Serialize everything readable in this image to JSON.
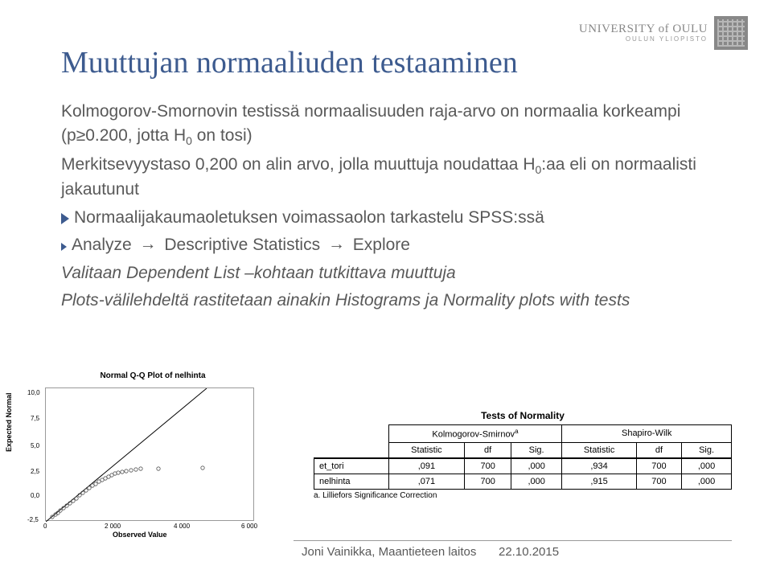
{
  "header": {
    "university": "UNIVERSITY of OULU",
    "sub": "OULUN YLIOPISTO"
  },
  "title": "Muuttujan normaaliuden testaaminen",
  "body": {
    "l1a": "Kolmogorov-Smornovin testissä normaalisuuden raja-arvo on normaalia korkeampi (p≥0.200, jotta H",
    "l1b": " on tosi)",
    "sub0": "0",
    "l2a": "Merkitsevyystaso 0,200 on alin arvo, jolla muuttuja noudattaa H",
    "l2b": ":aa eli on normaalisti jakautunut",
    "l3": "Normaalijakaumaoletuksen voimassaolon tarkastelu SPSS:ssä",
    "l4a": "Analyze ",
    "l4b": " Descriptive Statistics ",
    "l4c": " Explore",
    "l5a": "Valitaan ",
    "l5b": "Dependent List",
    "l5c": " –kohtaan tutkittava muuttuja",
    "l6a": "Plots",
    "l6b": "-välilehdeltä rastitetaan ainakin ",
    "l6c": "Histograms",
    "l6d": " ja ",
    "l6e": "Normality plots with tests"
  },
  "chart_data": {
    "type": "scatter",
    "title": "Normal Q-Q Plot of nelhinta",
    "xlabel": "Observed Value",
    "ylabel": "Expected Normal",
    "xlim": [
      0,
      6000
    ],
    "ylim": [
      -2.5,
      10.0
    ],
    "xticks": [
      0,
      2000,
      4000,
      6000
    ],
    "yticks": [
      -2.5,
      0.0,
      2.5,
      5.0,
      7.5,
      10.0
    ],
    "has_reference_line": true,
    "points_description": "dense cluster of hollow circles along a near-linear trend from approx (0,-2.5) to (2500,2.5), with sparse outliers near (3200,2.5) and (4500,2.5)"
  },
  "table": {
    "title": "Tests of Normality",
    "group1": "Kolmogorov-Smirnov",
    "group1_sup": "a",
    "group2": "Shapiro-Wilk",
    "cols": [
      "Statistic",
      "df",
      "Sig.",
      "Statistic",
      "df",
      "Sig."
    ],
    "rows": [
      {
        "label": "et_tori",
        "cells": [
          ",091",
          "700",
          ",000",
          ",934",
          "700",
          ",000"
        ]
      },
      {
        "label": "nelhinta",
        "cells": [
          ",071",
          "700",
          ",000",
          ",915",
          "700",
          ",000"
        ]
      }
    ],
    "note": "a. Lilliefors Significance Correction"
  },
  "footer": {
    "author": "Joni Vainikka, Maantieteen laitos",
    "date": "22.10.2015"
  }
}
